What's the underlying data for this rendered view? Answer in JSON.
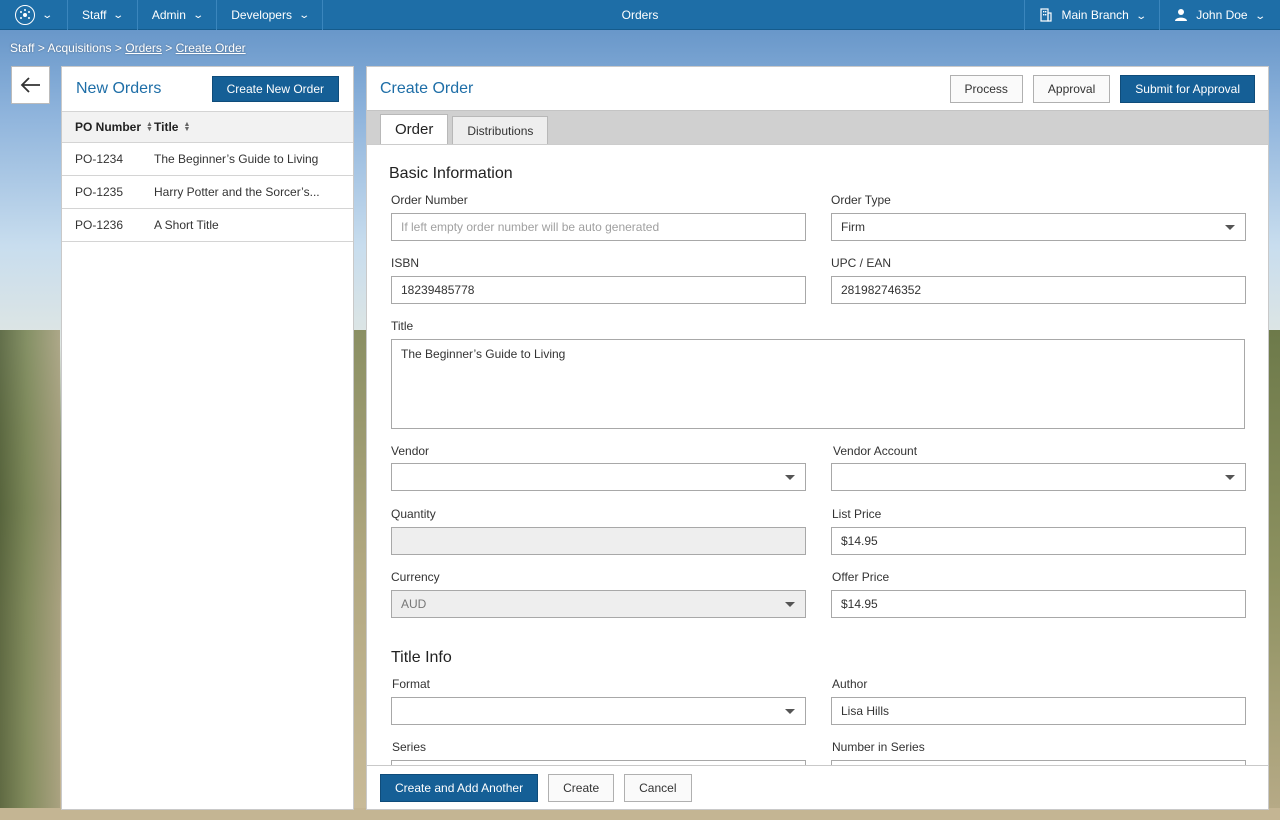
{
  "nav": {
    "menus": [
      {
        "label": "Staff"
      },
      {
        "label": "Admin"
      },
      {
        "label": "Developers"
      }
    ],
    "title": "Orders",
    "branch": "Main Branch",
    "user": "John Doe",
    "accent_color": "#1e6ea7"
  },
  "breadcrumb": {
    "staff": "Staff",
    "sep": ">",
    "acquisitions": "Acquisitions",
    "orders": "Orders",
    "create_order": "Create Order"
  },
  "left_panel": {
    "title": "New Orders",
    "create_button": "Create New Order",
    "columns": {
      "po": "PO Number",
      "title": "Title"
    },
    "rows": [
      {
        "po": "PO-1234",
        "title": "The Beginner’s Guide to Living"
      },
      {
        "po": "PO-1235",
        "title": "Harry Potter and the Sorcer’s..."
      },
      {
        "po": "PO-1236",
        "title": "A Short Title"
      }
    ]
  },
  "main": {
    "title": "Create Order",
    "actions": {
      "process": "Process",
      "approval": "Approval",
      "submit": "Submit for Approval"
    },
    "tabs": [
      {
        "label": "Order"
      },
      {
        "label": "Distributions"
      }
    ],
    "sections": {
      "basic": "Basic Information",
      "title_info": "Title Info"
    },
    "fields": {
      "order_number": {
        "label": "Order Number",
        "placeholder": "If left empty order number will be auto generated"
      },
      "order_type": {
        "label": "Order Type",
        "value": "Firm"
      },
      "isbn": {
        "label": "ISBN",
        "value": "18239485778"
      },
      "upc": {
        "label": "UPC / EAN",
        "value": "281982746352"
      },
      "title": {
        "label": "Title",
        "value": "The Beginner’s Guide to Living"
      },
      "vendor": {
        "label": "Vendor",
        "value": ""
      },
      "vendor_account": {
        "label": "Vendor Account",
        "value": ""
      },
      "quantity": {
        "label": "Quantity",
        "value": ""
      },
      "list_price": {
        "label": "List Price",
        "value": "$14.95"
      },
      "currency": {
        "label": "Currency",
        "value": "AUD"
      },
      "offer_price": {
        "label": "Offer Price",
        "value": "$14.95"
      },
      "format": {
        "label": "Format",
        "value": ""
      },
      "author": {
        "label": "Author",
        "value": "Lisa Hills"
      },
      "series": {
        "label": "Series",
        "value": ""
      },
      "number_in_series": {
        "label": "Number in Series",
        "value": ""
      }
    },
    "footer": {
      "create_add": "Create and Add Another",
      "create": "Create",
      "cancel": "Cancel"
    }
  }
}
